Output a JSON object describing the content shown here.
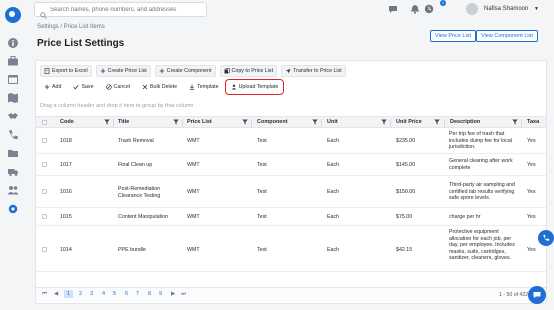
{
  "search": {
    "placeholder": "Search names, phone numbers, and addresses"
  },
  "header": {
    "notification_count": "1",
    "username": "Nafisa Shamoon"
  },
  "breadcrumb": "Settings / Price List Items",
  "page_title": "Price List Settings",
  "actions": {
    "view_price_list": "View Price List",
    "view_component_list": "View Component List"
  },
  "toolbar_row1": [
    "Export to Excel",
    "Create Price List",
    "Create Component",
    "Copy to Price List",
    "Transfer to Price List"
  ],
  "toolbar_row2": [
    "Add",
    "Save",
    "Cancel",
    "Bulk Delete",
    "Template",
    "Upload Template"
  ],
  "group_hint": "Drag a column header and drop it here to group by that column",
  "columns": [
    "Code",
    "Title",
    "Price List",
    "Component",
    "Unit",
    "Unit Price",
    "Description",
    "Taxa"
  ],
  "rows": [
    {
      "code": "1018",
      "title": "Trash Removal",
      "price_list": "WMT",
      "component": "Test",
      "unit": "Each",
      "unit_price": "$235.00",
      "description": "Per trip fee of trash that includes dump fee for local jurisdiction.",
      "taxable": "Yes"
    },
    {
      "code": "1017",
      "title": "Final Clean up",
      "price_list": "WMT",
      "component": "Test",
      "unit": "Each",
      "unit_price": "$145.00",
      "description": "General clearing after work complete",
      "taxable": "Yes"
    },
    {
      "code": "1016",
      "title": "Post-Remediation Clearance Testing",
      "price_list": "WMT",
      "component": "Test",
      "unit": "Each",
      "unit_price": "$150.00",
      "description": "Third-party air sampling and certified lab results verifying safe spore levels.",
      "taxable": "Yes"
    },
    {
      "code": "1015",
      "title": "Content Manipulation",
      "price_list": "WMT",
      "component": "Test",
      "unit": "Each",
      "unit_price": "$75.00",
      "description": "charge per hr",
      "taxable": "Yes"
    },
    {
      "code": "1014",
      "title": "PPE bundle",
      "price_list": "WMT",
      "component": "Test",
      "unit": "Each",
      "unit_price": "$42.15",
      "description": "Protective equipment allocation for each job, per day, per employee. Includes masks, suits, cartridges, sanitizer, cleaners, gloves.",
      "taxable": "Yes"
    }
  ],
  "pager": {
    "first": "⏮",
    "prev": "◀",
    "next": "▶",
    "last": "⏭",
    "pages": [
      "1",
      "2",
      "3",
      "4",
      "5",
      "6",
      "7",
      "8",
      "9"
    ],
    "info": "1 - 50 of 422 items"
  }
}
